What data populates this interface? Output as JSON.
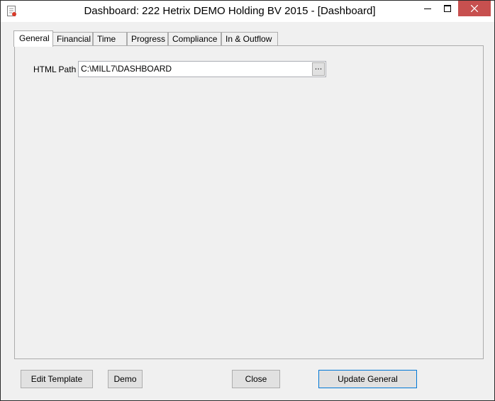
{
  "window": {
    "title": "Dashboard: 222 Hetrix DEMO Holding BV 2015 - [Dashboard]"
  },
  "tabs": [
    {
      "label": "General",
      "active": true
    },
    {
      "label": "Financial",
      "active": false
    },
    {
      "label": "Time",
      "active": false
    },
    {
      "label": "Progress",
      "active": false
    },
    {
      "label": "Compliance",
      "active": false
    },
    {
      "label": "In & Outflow",
      "active": false
    }
  ],
  "general": {
    "html_path_label": "HTML Path",
    "html_path_value": "C:\\MILL7\\DASHBOARD",
    "browse_label": "..."
  },
  "buttons": {
    "edit_template": "Edit Template",
    "demo": "Demo",
    "close": "Close",
    "update_general": "Update General"
  },
  "colors": {
    "close_button": "#c7504f",
    "focus_border": "#0078d7"
  }
}
